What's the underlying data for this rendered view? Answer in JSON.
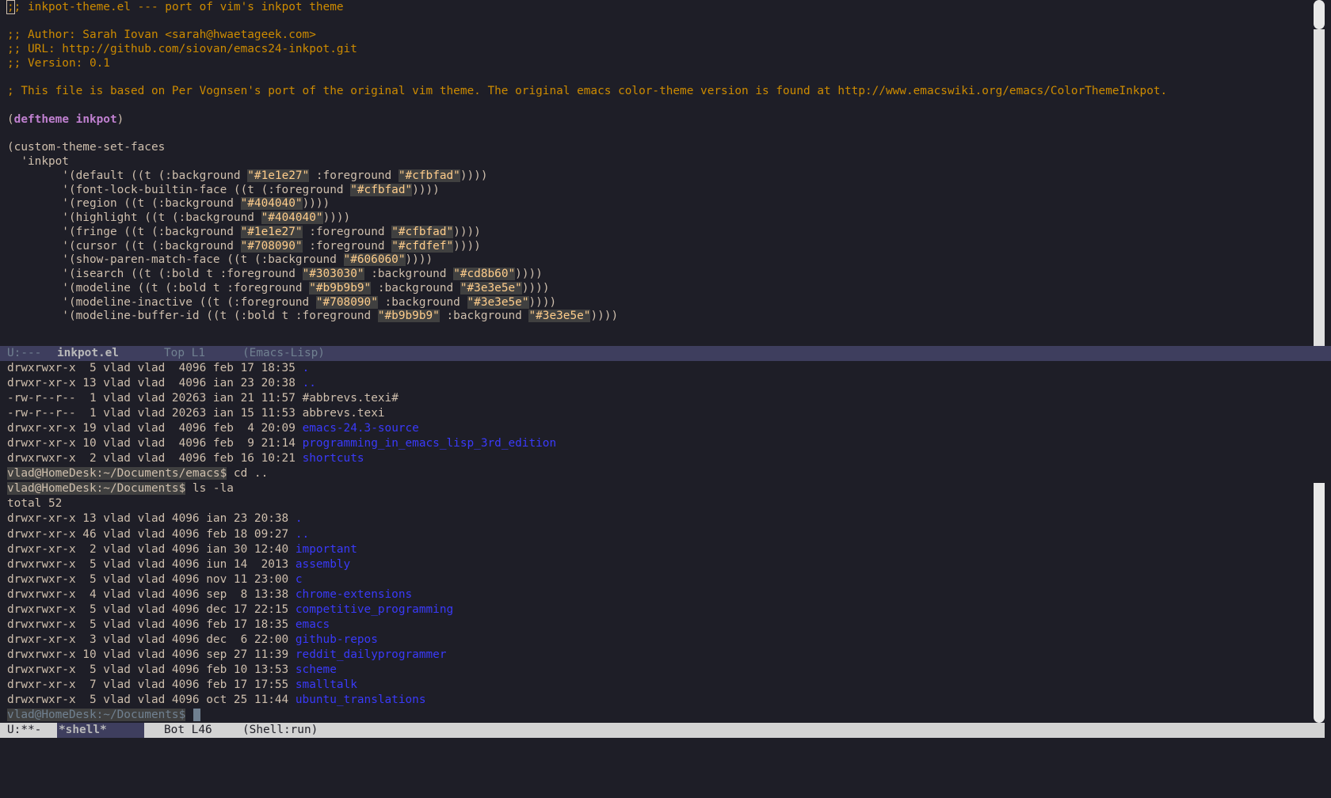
{
  "editor": {
    "comment_lines": [
      ";; inkpot-theme.el --- port of vim's inkpot theme",
      ";; Author: Sarah Iovan <sarah@hwaetageek.com>",
      ";; URL: http://github.com/siovan/emacs24-inkpot.git",
      ";; Version: 0.1",
      "; This file is based on Per Vognsen's port of the original vim theme. The original emacs color-theme version is found at http://www.emacswiki.org/emacs/ColorThemeInkpot."
    ],
    "deftheme_open": "(",
    "deftheme_keyword": "deftheme",
    "deftheme_name": "inkpot",
    "deftheme_close": ")",
    "custom_open": "(custom-theme-set-faces",
    "custom_quote": "  'inkpot",
    "faces": {
      "default": {
        "pre": "        '(default ((t (:background ",
        "v1": "\"#1e1e27\"",
        "mid": " :foreground ",
        "v2": "\"#cfbfad\"",
        "post": "))))"
      },
      "builtin": {
        "pre": "        '(font-lock-builtin-face ((t (:foreground ",
        "v1": "\"#cfbfad\"",
        "post": "))))"
      },
      "region": {
        "pre": "        '(region ((t (:background ",
        "v1": "\"#404040\"",
        "post": "))))"
      },
      "highlight": {
        "pre": "        '(highlight ((t (:background ",
        "v1": "\"#404040\"",
        "post": "))))"
      },
      "fringe": {
        "pre": "        '(fringe ((t (:background ",
        "v1": "\"#1e1e27\"",
        "mid": " :foreground ",
        "v2": "\"#cfbfad\"",
        "post": "))))"
      },
      "cursor": {
        "pre": "        '(cursor ((t (:background ",
        "v1": "\"#708090\"",
        "mid": " :foreground ",
        "v2": "\"#cfdfef\"",
        "post": "))))"
      },
      "showparen": {
        "pre": "        '(show-paren-match-face ((t (:background ",
        "v1": "\"#606060\"",
        "post": "))))"
      },
      "isearch": {
        "pre": "        '(isearch ((t (:bold t :foreground ",
        "v1": "\"#303030\"",
        "mid": " :background ",
        "v2": "\"#cd8b60\"",
        "post": "))))"
      },
      "modeline": {
        "pre": "        '(modeline ((t (:bold t :foreground ",
        "v1": "\"#b9b9b9\"",
        "mid": " :background ",
        "v2": "\"#3e3e5e\"",
        "post": "))))"
      },
      "modeline_inactive": {
        "pre": "        '(modeline-inactive ((t (:foreground ",
        "v1": "\"#708090\"",
        "mid": " :background ",
        "v2": "\"#3e3e5e\"",
        "post": "))))"
      },
      "modeline_buffer_id": {
        "pre": "        '(modeline-buffer-id ((t (:bold t :foreground ",
        "v1": "\"#b9b9b9\"",
        "mid": " :background ",
        "v2": "\"#3e3e5e\"",
        "post": "))))"
      }
    }
  },
  "modeline_top": {
    "status": "U:---",
    "buffer": "inkpot.el",
    "position": "Top L1",
    "mode": "(Emacs-Lisp)"
  },
  "shell": {
    "ls1": [
      {
        "meta": "drwxrwxr-x  5 vlad vlad  4096 feb 17 18:35",
        "name": ".",
        "dir": true
      },
      {
        "meta": "drwxr-xr-x 13 vlad vlad  4096 ian 23 20:38",
        "name": "..",
        "dir": true
      },
      {
        "meta": "-rw-r--r--  1 vlad vlad 20263 ian 21 11:57",
        "name": "#abbrevs.texi#",
        "dir": false
      },
      {
        "meta": "-rw-r--r--  1 vlad vlad 20263 ian 15 11:53",
        "name": "abbrevs.texi",
        "dir": false
      },
      {
        "meta": "drwxr-xr-x 19 vlad vlad  4096 feb  4 20:09",
        "name": "emacs-24.3-source",
        "dir": true
      },
      {
        "meta": "drwxr-xr-x 10 vlad vlad  4096 feb  9 21:14",
        "name": "programming_in_emacs_lisp_3rd_edition",
        "dir": true
      },
      {
        "meta": "drwxrwxr-x  2 vlad vlad  4096 feb 16 10:21",
        "name": "shortcuts",
        "dir": true
      }
    ],
    "prompt1": "vlad@HomeDesk:~/Documents/emacs$",
    "cmd1": " cd ..",
    "prompt2": "vlad@HomeDesk:~/Documents$",
    "cmd2": " ls -la",
    "total": "total 52",
    "ls2": [
      {
        "meta": "drwxr-xr-x 13 vlad vlad 4096 ian 23 20:38",
        "name": "."
      },
      {
        "meta": "drwxr-xr-x 46 vlad vlad 4096 feb 18 09:27",
        "name": ".."
      },
      {
        "meta": "drwxr-xr-x  2 vlad vlad 4096 ian 30 12:40",
        "name": "important"
      },
      {
        "meta": "drwxrwxr-x  5 vlad vlad 4096 iun 14  2013",
        "name": "assembly"
      },
      {
        "meta": "drwxrwxr-x  5 vlad vlad 4096 nov 11 23:00",
        "name": "c"
      },
      {
        "meta": "drwxrwxr-x  4 vlad vlad 4096 sep  8 13:38",
        "name": "chrome-extensions"
      },
      {
        "meta": "drwxrwxr-x  5 vlad vlad 4096 dec 17 22:15",
        "name": "competitive_programming"
      },
      {
        "meta": "drwxrwxr-x  5 vlad vlad 4096 feb 17 18:35",
        "name": "emacs"
      },
      {
        "meta": "drwxr-xr-x  3 vlad vlad 4096 dec  6 22:00",
        "name": "github-repos"
      },
      {
        "meta": "drwxrwxr-x 10 vlad vlad 4096 sep 27 11:39",
        "name": "reddit_dailyprogrammer"
      },
      {
        "meta": "drwxrwxr-x  5 vlad vlad 4096 feb 10 13:53",
        "name": "scheme"
      },
      {
        "meta": "drwxr-xr-x  7 vlad vlad 4096 feb 17 17:55",
        "name": "smalltalk"
      },
      {
        "meta": "drwxrwxr-x  5 vlad vlad 4096 oct 25 11:44",
        "name": "ubuntu_translations"
      }
    ],
    "prompt3": "vlad@HomeDesk:~/Documents$"
  },
  "modeline_bottom": {
    "status": "U:**-",
    "buffer": "*shell*",
    "position": "Bot L46",
    "mode": "(Shell:run)"
  },
  "colors": {
    "background": "#1e1e27",
    "foreground": "#cfbfad",
    "comment": "#cd8b00",
    "directory": "#3a3afa",
    "string_bg": "#404040"
  }
}
